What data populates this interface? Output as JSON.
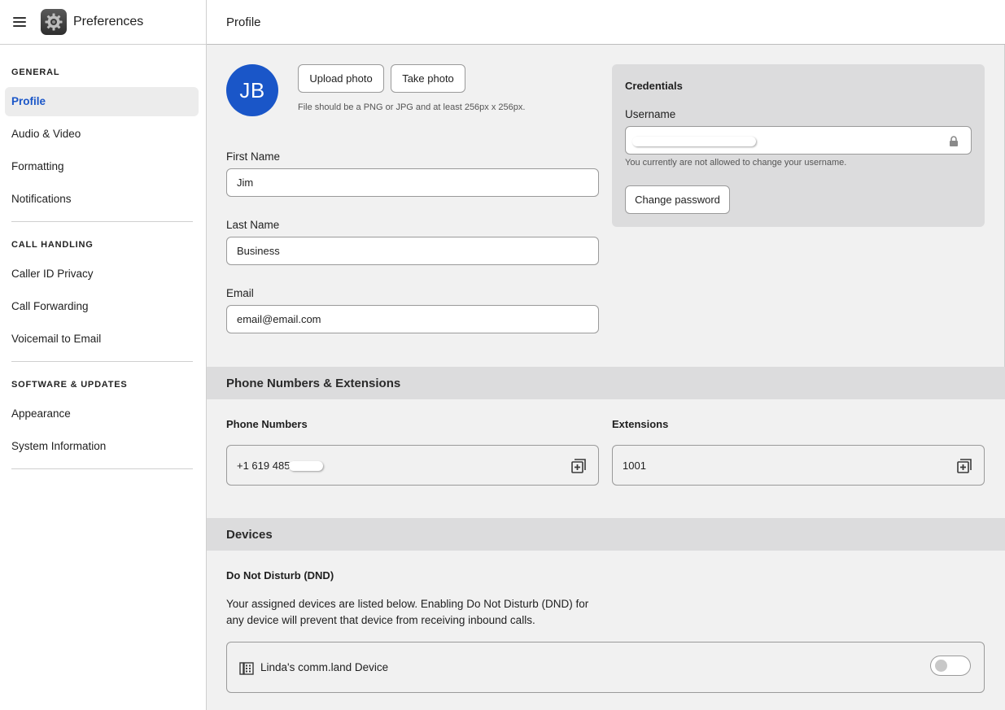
{
  "app": {
    "title": "Preferences"
  },
  "sidebar": {
    "sections": [
      {
        "heading": "GENERAL",
        "items": [
          "Profile",
          "Audio & Video",
          "Formatting",
          "Notifications"
        ]
      },
      {
        "heading": "CALL HANDLING",
        "items": [
          "Caller ID Privacy",
          "Call Forwarding",
          "Voicemail to Email"
        ]
      },
      {
        "heading": "SOFTWARE & UPDATES",
        "items": [
          "Appearance",
          "System Information"
        ]
      }
    ],
    "active_item": "Profile"
  },
  "main": {
    "title": "Profile",
    "profile": {
      "avatar_initials": "JB",
      "upload_label": "Upload photo",
      "take_label": "Take photo",
      "photo_hint": "File should be a PNG or JPG and at least 256px x 256px.",
      "first_name_label": "First Name",
      "first_name_value": "Jim",
      "last_name_label": "Last Name",
      "last_name_value": "Business",
      "email_label": "Email",
      "email_value": "email@email.com"
    },
    "credentials": {
      "title": "Credentials",
      "username_label": "Username",
      "username_hint": "You currently are not allowed to change your username.",
      "change_password_label": "Change password"
    },
    "phone_section": {
      "title": "Phone Numbers & Extensions",
      "phone_numbers_label": "Phone Numbers",
      "phone_number_value": "+1 619 485",
      "extensions_label": "Extensions",
      "extension_value": "1001"
    },
    "devices": {
      "title": "Devices",
      "dnd_heading": "Do Not Disturb (DND)",
      "dnd_description": "Your assigned devices are listed below. Enabling Do Not Disturb (DND) for any device will prevent that device from receiving inbound calls.",
      "device_name": "Linda's comm.land Device",
      "dnd_enabled": false
    }
  },
  "colors": {
    "accent": "#1a56c8",
    "band": "#dcdcdd",
    "main_bg": "#f1f1f1"
  }
}
